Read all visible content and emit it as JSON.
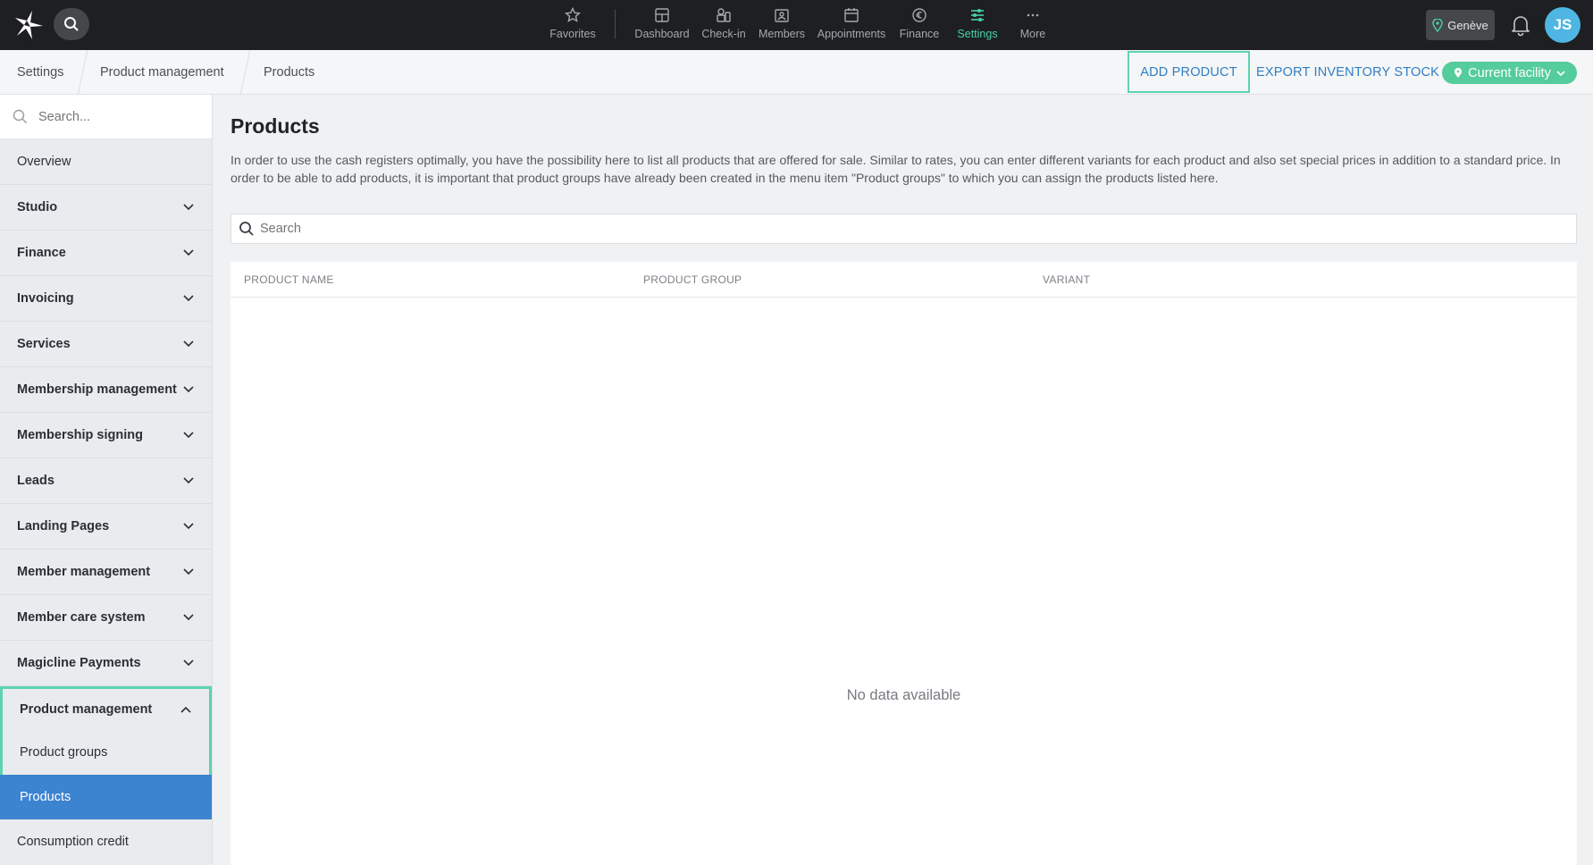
{
  "topbar": {
    "nav": [
      {
        "label": "Favorites",
        "icon": "star-icon",
        "active": false
      },
      {
        "label": "Dashboard",
        "icon": "dashboard-icon",
        "active": false
      },
      {
        "label": "Check-in",
        "icon": "check-in-icon",
        "active": false
      },
      {
        "label": "Members",
        "icon": "members-icon",
        "active": false
      },
      {
        "label": "Appointments",
        "icon": "calendar-icon",
        "active": false
      },
      {
        "label": "Finance",
        "icon": "euro-icon",
        "active": false
      },
      {
        "label": "Settings",
        "icon": "sliders-icon",
        "active": true
      },
      {
        "label": "More",
        "icon": "more-icon",
        "active": false
      }
    ],
    "location": "Genève",
    "avatar_initials": "JS"
  },
  "breadcrumb": [
    "Settings",
    "Product management",
    "Products"
  ],
  "actions": {
    "add_product": "ADD PRODUCT",
    "export_stock": "EXPORT INVENTORY STOCK",
    "facility": "Current facility"
  },
  "sidebar": {
    "search_placeholder": "Search...",
    "items": [
      {
        "label": "Overview",
        "type": "plain"
      },
      {
        "label": "Studio",
        "type": "group"
      },
      {
        "label": "Finance",
        "type": "group"
      },
      {
        "label": "Invoicing",
        "type": "group"
      },
      {
        "label": "Services",
        "type": "group"
      },
      {
        "label": "Membership management",
        "type": "group"
      },
      {
        "label": "Membership signing",
        "type": "group"
      },
      {
        "label": "Leads",
        "type": "group"
      },
      {
        "label": "Landing Pages",
        "type": "group"
      },
      {
        "label": "Member management",
        "type": "group"
      },
      {
        "label": "Member care system",
        "type": "group"
      },
      {
        "label": "Magicline Payments",
        "type": "group"
      }
    ],
    "expanded": {
      "label": "Product management",
      "children": [
        "Product groups",
        "Products"
      ],
      "selected": "Products"
    },
    "after": "Consumption credit"
  },
  "main": {
    "title": "Products",
    "description": "In order to use the cash registers optimally, you have the possibility here to list all products that are offered for sale. Similar to rates, you can enter different variants for each product and also set special prices in addition to a standard price. In order to be able to add products, it is important that product groups have already been created in the menu item \"Product groups\" to which you can assign the products listed here.",
    "search_placeholder": "Search",
    "columns": [
      "PRODUCT NAME",
      "PRODUCT GROUP",
      "VARIANT"
    ],
    "empty_text": "No data available"
  },
  "colors": {
    "accent_green": "#46d2a8",
    "highlight_outline": "#5dd3b1",
    "link_blue": "#2f7ec5",
    "selected_blue": "#3c83d0",
    "facility_green": "#55cc9b",
    "avatar_blue": "#4fb6e3"
  }
}
